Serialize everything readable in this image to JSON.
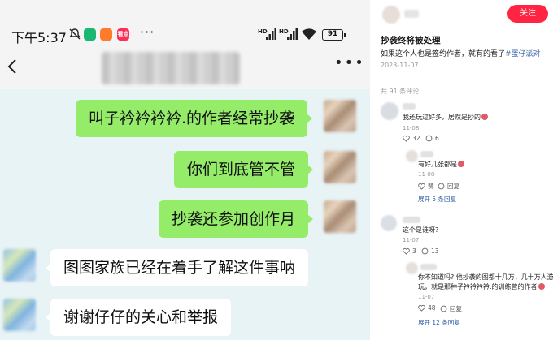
{
  "status_bar": {
    "time": "下午5:37",
    "app_badge": "看点",
    "overflow": "···",
    "signal_1": "HD",
    "signal_2": "HD",
    "battery": "91"
  },
  "chat": {
    "more": "•••",
    "messages": [
      {
        "side": "out",
        "text": "叫子衿衿衿衿.的作者经常抄袭"
      },
      {
        "side": "out",
        "text": "你们到底管不管"
      },
      {
        "side": "out",
        "text": "抄袭还参加创作月"
      },
      {
        "side": "in",
        "text": "图图家族已经在着手了解这件事呐"
      },
      {
        "side": "in",
        "text": "谢谢仔仔的关心和举报"
      }
    ]
  },
  "post": {
    "follow_label": "关注",
    "title": "抄袭终将被处理",
    "body": "如果这个人也是签约作者，就有的看了",
    "tag": "#蛋仔派对",
    "date": "2023-11-07",
    "comment_count": "共 91 条评论"
  },
  "comments": [
    {
      "text": "我还玩过好多，居然是抄的",
      "date": "11-08",
      "likes": "32",
      "replies": "6"
    },
    {
      "text": "有好几张都是",
      "date": "11-08",
      "likes_label": "赞",
      "reply_label": "回复",
      "more": "展开 5 条回复"
    },
    {
      "text": "这个是谁呀?",
      "date": "11-07",
      "likes": "3",
      "replies": "13"
    },
    {
      "text_line1": "你不知道吗? 他抄袭的图都十几万，几十万人游",
      "text_line2": "玩，就是那种子衿衿衿衿.的训练营的作者",
      "date": "11-07",
      "likes": "48",
      "reply_label": "回复",
      "more": "展开 12 条回复"
    }
  ],
  "colors": {
    "bubble_out": "#95ec69",
    "bubble_in": "#ffffff",
    "chat_bg": "#e8f3f6",
    "follow": "#ff2442",
    "link": "#2b5aa6"
  }
}
